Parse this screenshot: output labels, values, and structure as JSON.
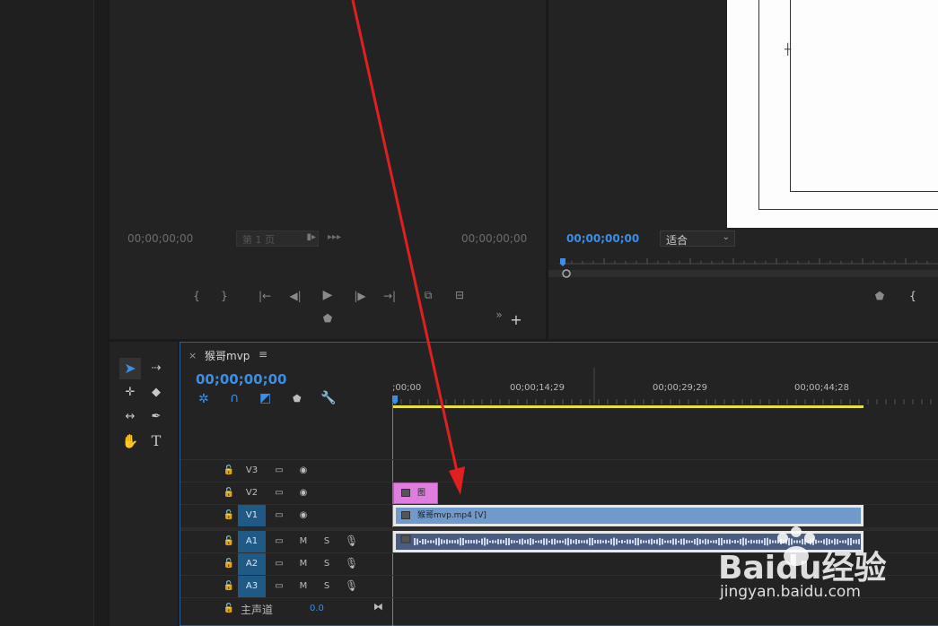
{
  "source_monitor": {
    "timecode_left": "00;00;00;00",
    "page_field": "第 1 页",
    "timecode_right": "00;00;00;00",
    "controls": [
      "{",
      "}",
      "|←",
      "◀|",
      "▶",
      "|▶",
      "→|"
    ]
  },
  "program_monitor": {
    "timecode": "00;00;00;00",
    "fit_select": "适合"
  },
  "timeline": {
    "close_symbol": "×",
    "sequence_name": "猴哥mvp",
    "menu_symbol": "≡",
    "timecode": "00;00;00;00",
    "ruler": [
      ";00;00",
      "00;00;14;29",
      "00;00;29;29",
      "00;00;44;28"
    ],
    "video_tracks": [
      {
        "label": "V3",
        "active": false
      },
      {
        "label": "V2",
        "active": false
      },
      {
        "label": "V1",
        "active": true
      }
    ],
    "audio_tracks": [
      {
        "label": "A1",
        "m": "M",
        "s": "S"
      },
      {
        "label": "A2",
        "m": "M",
        "s": "S"
      },
      {
        "label": "A3",
        "m": "M",
        "s": "S"
      }
    ],
    "master": {
      "label": "主声道",
      "value": "0.0"
    },
    "clips": {
      "v2_clip": "图",
      "v1_clip": "猴哥mvp.mp4 [V]"
    },
    "colors": {
      "playhead": "#3b8ee6",
      "work_area": "#e8e23a",
      "v2_clip": "#e07ee0",
      "v1_clip": "#6f9acb",
      "audio_clip": "#6b7fa0"
    }
  },
  "annotation": {
    "arrow_color": "#e02020"
  },
  "watermark": {
    "brand": "Baidu经验",
    "url": "jingyan.baidu.com"
  }
}
